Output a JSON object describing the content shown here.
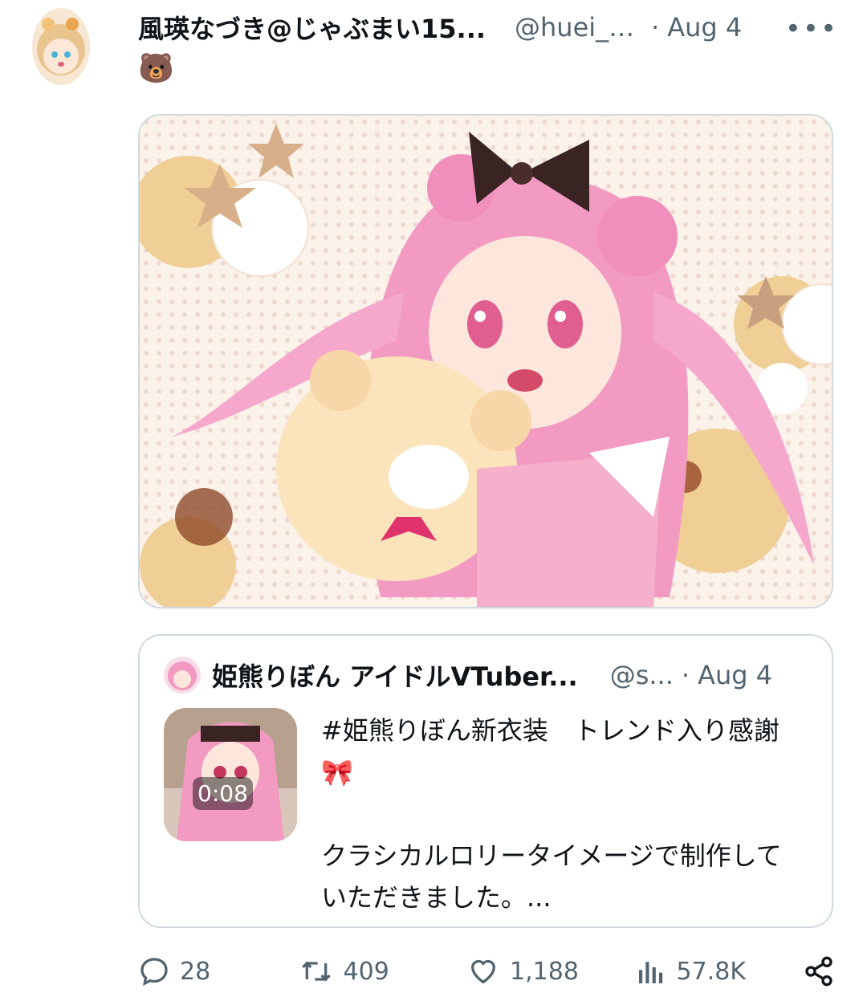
{
  "tweet": {
    "display_name": "風瑛なづき@じゃぶまい15...",
    "handle": "@huei_n...",
    "separator": "·",
    "date": "Aug 4",
    "more_icon": "more-icon",
    "text": "🐻"
  },
  "quoted": {
    "display_name": "姫熊りぼん アイドルVTuber...",
    "handle": "@s...",
    "separator": "·",
    "date": "Aug 4",
    "video_duration": "0:08",
    "text_line1": "#姫熊りぼん新衣装　トレンド入り感謝🎀",
    "text_line2": "クラシカルロリータイメージで制作していただきました。..."
  },
  "actions": {
    "replies": "28",
    "reposts": "409",
    "likes": "1,188",
    "views": "57.8K"
  },
  "colors": {
    "text": "#0f1419",
    "secondary": "#536471",
    "border": "#cfd9de",
    "hair_pink": "#f29ac1"
  }
}
